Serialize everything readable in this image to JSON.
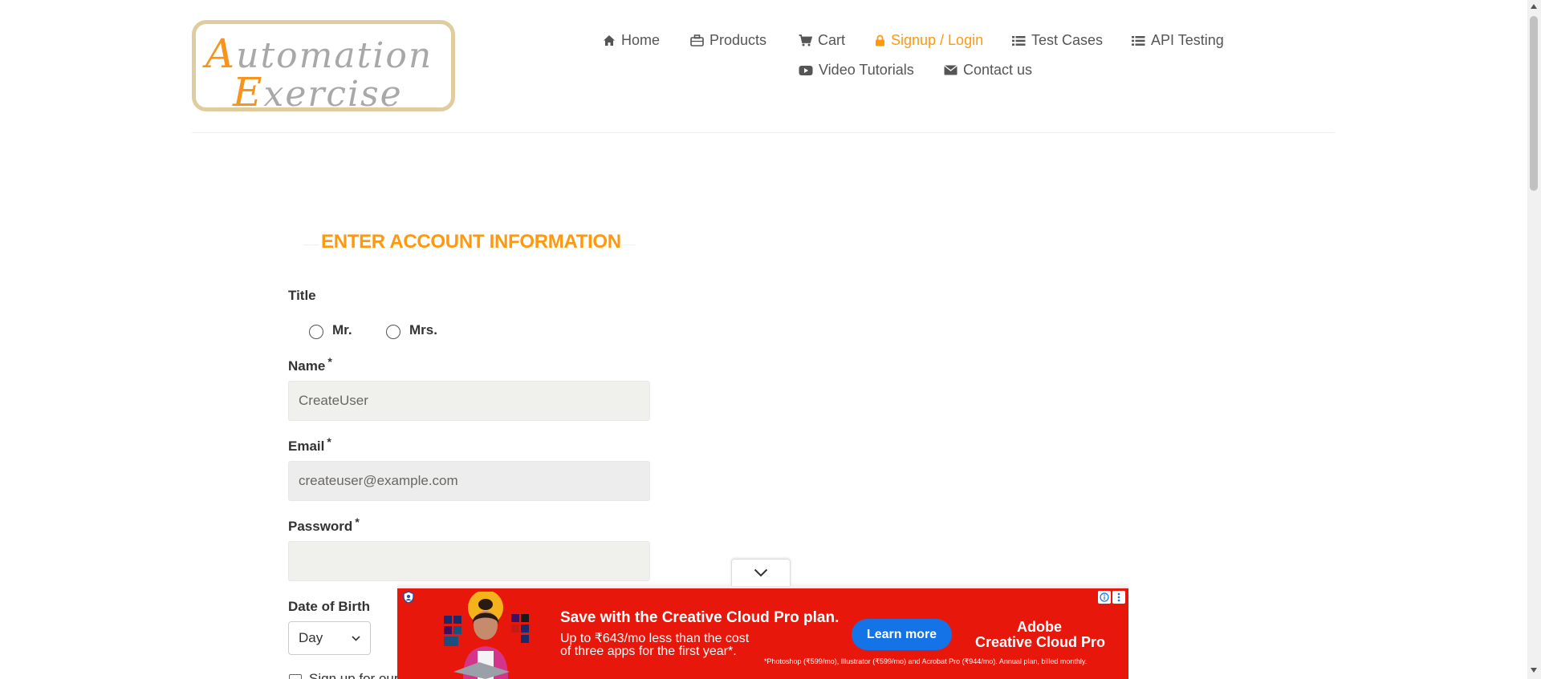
{
  "logo": {
    "line1_cap": "A",
    "line1_rest": "utomation",
    "line2_cap": "E",
    "line2_rest": "xercise"
  },
  "nav": {
    "items": [
      {
        "label": "Home",
        "icon": "home-icon"
      },
      {
        "label": "Products",
        "icon": "briefcase-icon"
      },
      {
        "label": "Cart",
        "icon": "cart-icon"
      },
      {
        "label": "Signup / Login",
        "icon": "lock-icon",
        "active": true
      },
      {
        "label": "Test Cases",
        "icon": "list-icon"
      },
      {
        "label": "API Testing",
        "icon": "list-icon"
      },
      {
        "label": "Video Tutorials",
        "icon": "youtube-icon"
      },
      {
        "label": "Contact us",
        "icon": "envelope-icon"
      }
    ]
  },
  "form": {
    "heading": "ENTER ACCOUNT INFORMATION",
    "title_label": "Title",
    "title_options": [
      "Mr.",
      "Mrs."
    ],
    "name_label": "Name",
    "name_value": "CreateUser",
    "email_label": "Email",
    "email_value": "createuser@example.com",
    "password_label": "Password",
    "password_value": "",
    "required_mark": "*",
    "dob_label": "Date of Birth",
    "dob_day": "Day",
    "newsletter_label": "Sign up for our newsletter!"
  },
  "ad": {
    "headline": "Save with the Creative Cloud Pro plan.",
    "sub1": "Up to ₹643/mo less than the cost",
    "sub2": "of three apps for the first year*.",
    "cta": "Learn more",
    "brand1": "Adobe",
    "brand2": "Creative Cloud Pro",
    "fine_print": "*Photoshop (₹599/mo), Illustrator (₹599/mo) and Acrobat Pro (₹944/mo). Annual plan, billed monthly."
  },
  "colors": {
    "accent": "#fe980f",
    "ad_bg": "#e8170b",
    "cta": "#1473e6"
  }
}
